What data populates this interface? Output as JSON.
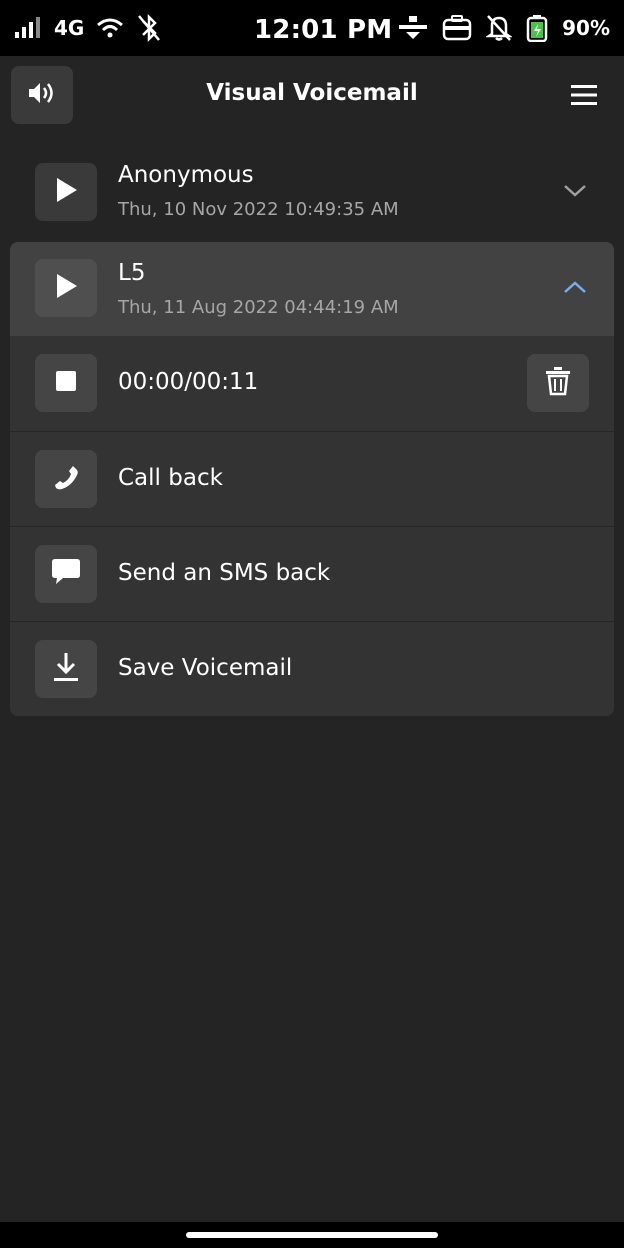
{
  "status_bar": {
    "network": "4G",
    "time": "12:01 PM",
    "battery": "90%",
    "icons": [
      "signal-icon",
      "wifi-icon",
      "bluetooth-off-icon",
      "vpn-icon",
      "work-profile-icon",
      "notifications-off-icon",
      "battery-icon"
    ]
  },
  "header": {
    "title": "Visual Voicemail",
    "left_icon": "speaker-icon",
    "right_icon": "menu-icon"
  },
  "voicemails": [
    {
      "name": "Anonymous",
      "date": "Thu, 10 Nov 2022 10:49:35 AM",
      "expanded": false
    },
    {
      "name": "L5",
      "date": "Thu, 11 Aug 2022 04:44:19 AM",
      "expanded": true
    }
  ],
  "player": {
    "progress": "00:00/00:11"
  },
  "actions": {
    "call_back": "Call back",
    "sms_back": "Send an SMS back",
    "save": "Save Voicemail"
  },
  "colors": {
    "background": "#242424",
    "accent": "#78aeed"
  }
}
